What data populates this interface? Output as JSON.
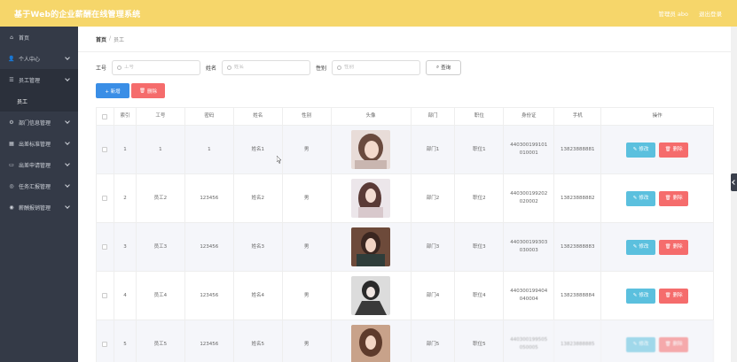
{
  "header": {
    "title": "基于Web的企业薪酬在线管理系统",
    "user": "管理员 abo",
    "logout": "退出登录"
  },
  "sidebar": {
    "items": [
      {
        "label": "首页",
        "icon": "home-icon"
      },
      {
        "label": "个人中心",
        "icon": "user-icon"
      },
      {
        "label": "员工管理",
        "icon": "list-icon",
        "sub": [
          "员工"
        ]
      },
      {
        "label": "部门信息管理",
        "icon": "gear-icon"
      },
      {
        "label": "出差标准管理",
        "icon": "chart-icon"
      },
      {
        "label": "出差申请管理",
        "icon": "doc-icon"
      },
      {
        "label": "任务汇报管理",
        "icon": "task-icon"
      },
      {
        "label": "薪酬报销管理",
        "icon": "money-icon"
      }
    ]
  },
  "breadcrumb": {
    "home": "首页",
    "sep": "/",
    "current": "员工"
  },
  "search": {
    "gonghao_label": "工号",
    "gonghao_placeholder": "工号",
    "name_label": "姓名",
    "name_placeholder": "姓名",
    "gender_label": "性别",
    "gender_placeholder": "性别",
    "query_label": "查询"
  },
  "actions": {
    "add_label": "+ 新增",
    "delete_label": "删除"
  },
  "table": {
    "headers": [
      "",
      "索引",
      "工号",
      "密码",
      "姓名",
      "性别",
      "头像",
      "部门",
      "职位",
      "身份证",
      "手机",
      "操作"
    ],
    "rows": [
      {
        "index": "1",
        "gonghao": "1",
        "password": "1",
        "name": "姓名1",
        "gender": "男",
        "dept": "部门1",
        "position": "职位1",
        "id_line1": "440300199101",
        "id_line2": "010001",
        "phone": "13823888881"
      },
      {
        "index": "2",
        "gonghao": "员工2",
        "password": "123456",
        "name": "姓名2",
        "gender": "男",
        "dept": "部门2",
        "position": "职位2",
        "id_line1": "440300199202",
        "id_line2": "020002",
        "phone": "13823888882"
      },
      {
        "index": "3",
        "gonghao": "员工3",
        "password": "123456",
        "name": "姓名3",
        "gender": "男",
        "dept": "部门3",
        "position": "职位3",
        "id_line1": "440300199303",
        "id_line2": "030003",
        "phone": "13823888883"
      },
      {
        "index": "4",
        "gonghao": "员工4",
        "password": "123456",
        "name": "姓名4",
        "gender": "男",
        "dept": "部门4",
        "position": "职位4",
        "id_line1": "440300199404",
        "id_line2": "040004",
        "phone": "13823888884"
      },
      {
        "index": "5",
        "gonghao": "员工5",
        "password": "123456",
        "name": "姓名5",
        "gender": "男",
        "dept": "部门5",
        "position": "职位5",
        "id_line1": "440300199505",
        "id_line2": "050005",
        "phone": "13823888885"
      }
    ],
    "edit_label": "修改",
    "row_delete_label": "删除"
  }
}
